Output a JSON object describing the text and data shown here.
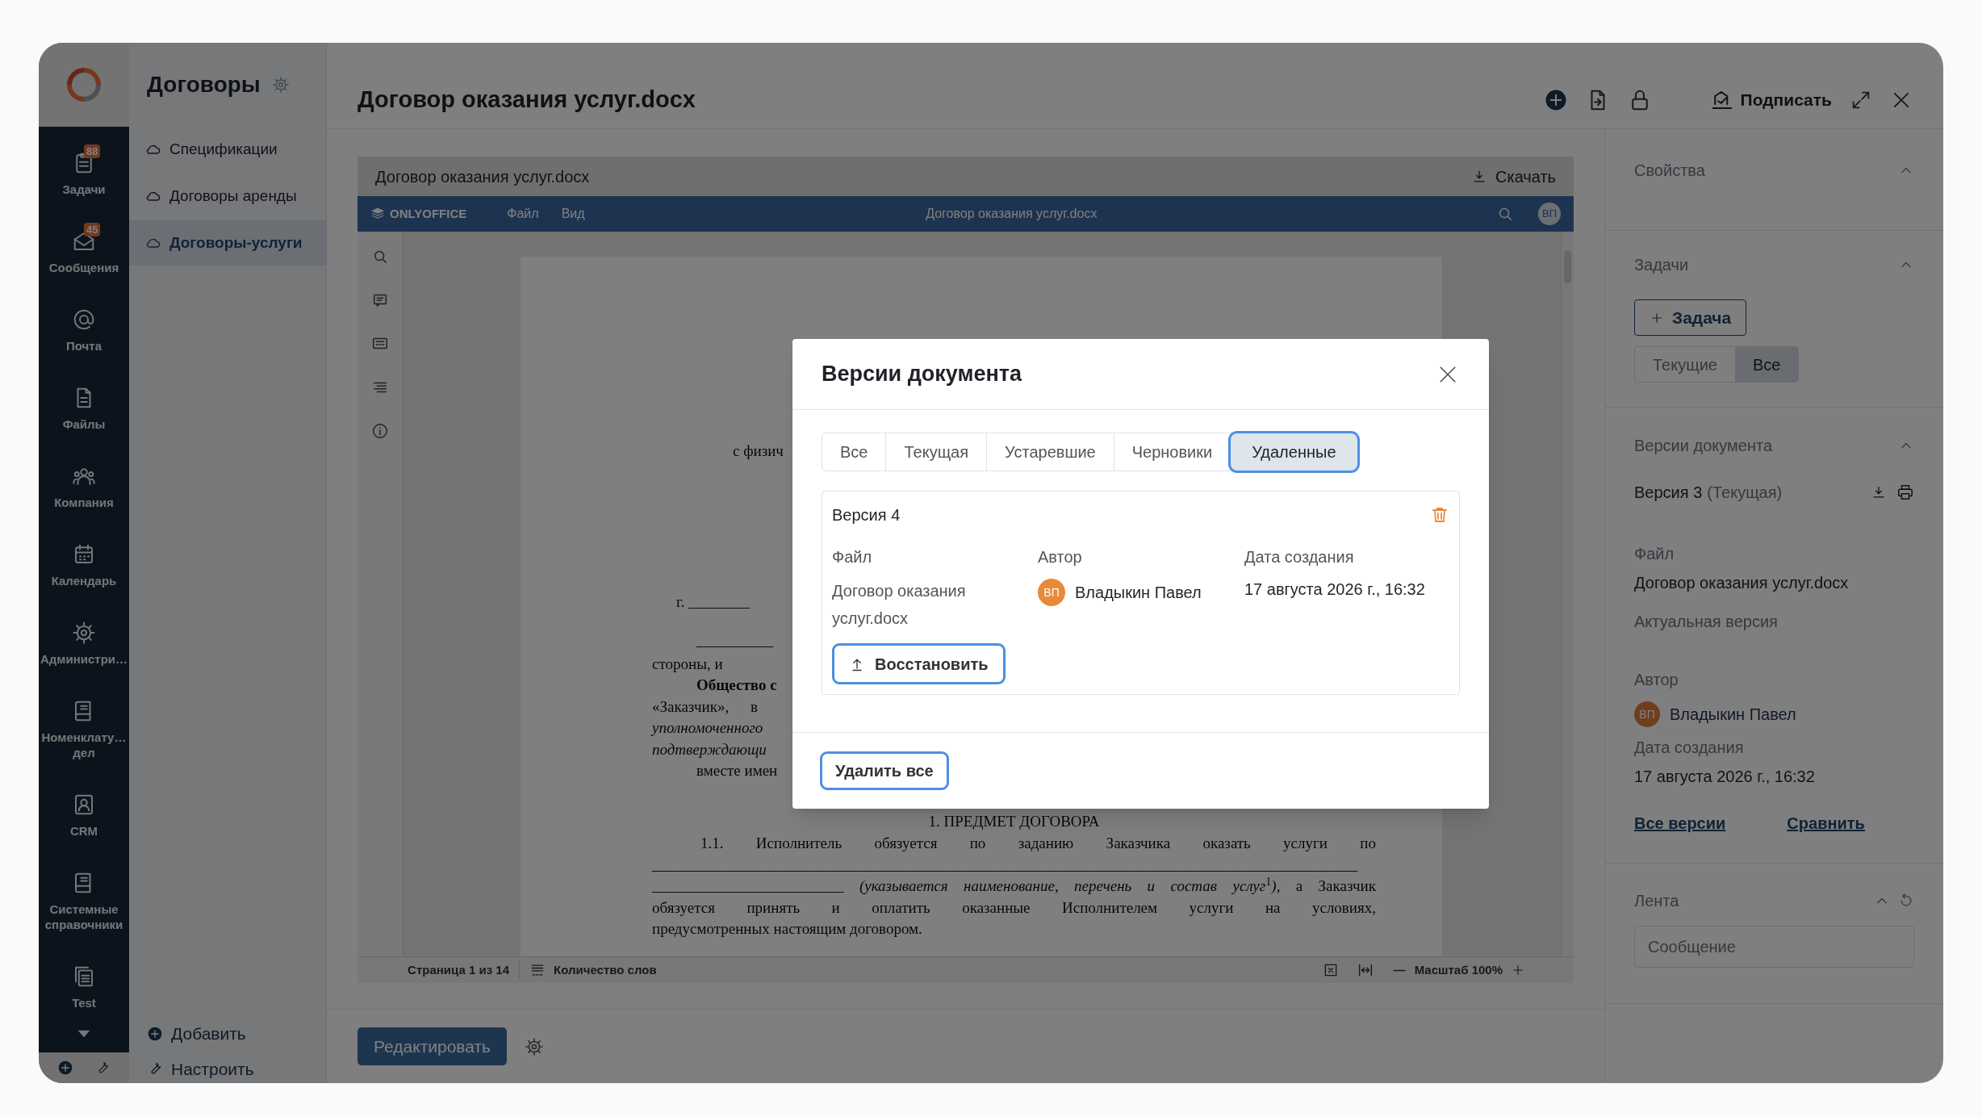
{
  "rail": {
    "items": [
      {
        "kind": "tasks",
        "label": "Задачи",
        "badge": "88"
      },
      {
        "kind": "messages",
        "label": "Сообщения",
        "badge": "45"
      },
      {
        "kind": "mail",
        "label": "Почта"
      },
      {
        "kind": "files",
        "label": "Файлы"
      },
      {
        "kind": "company",
        "label": "Компания"
      },
      {
        "kind": "calendar",
        "label": "Календарь"
      },
      {
        "kind": "admin",
        "label": "Администри…"
      },
      {
        "kind": "book",
        "label": "Номенклату… дел"
      },
      {
        "kind": "crm",
        "label": "CRM"
      },
      {
        "kind": "book",
        "label": "Системные справочники"
      },
      {
        "kind": "test",
        "label": "Test"
      }
    ]
  },
  "sidebar": {
    "title": "Договоры",
    "items": [
      {
        "label": "Спецификации",
        "selected": false
      },
      {
        "label": "Договоры аренды",
        "selected": false
      },
      {
        "label": "Договоры-услуги",
        "selected": true
      }
    ],
    "actions": [
      {
        "kind": "add",
        "label": "Добавить"
      },
      {
        "kind": "configure",
        "label": "Настроить"
      }
    ]
  },
  "header": {
    "title": "Договор оказания услуг.docx",
    "sign": "Подписать"
  },
  "viewer": {
    "file_name": "Договор оказания услуг.docx",
    "download": "Скачать",
    "brand": "ONLYOFFICE",
    "menu": [
      "Файл",
      "Вид"
    ],
    "editor_title": "Договор оказания услуг.docx",
    "user_initials": "ВП",
    "lines": [
      {
        "kind": "wide",
        "text": "с физич"
      },
      {
        "kind": "offset",
        "text": "г. ________"
      },
      {
        "kind": "indent",
        "text": "__________"
      },
      {
        "kind": "plain",
        "text": "стороны, и"
      },
      {
        "kind": "bold-indent",
        "text": "Общество с"
      },
      {
        "kind": "spread",
        "text": "«Заказчик», в"
      },
      {
        "kind": "italic",
        "text": "уполномоченного"
      },
      {
        "kind": "italic",
        "text": "подтверждающи"
      },
      {
        "kind": "indent",
        "text": "вместе имен"
      },
      {
        "kind": "heading",
        "text": "1. ПРЕДМЕТ ДОГОВОРА"
      },
      {
        "kind": "justify-indent",
        "text": "1.1. Исполнитель обязуется по заданию Заказчика оказать услуги по"
      },
      {
        "kind": "justify",
        "text": "____________________________________________________________________________________________"
      },
      {
        "kind": "justify",
        "text": "_________________________ *(указывается наименование, перечень и состав услуг*$^{1}$*)*, а Заказчик"
      },
      {
        "kind": "justify",
        "text": "обязуется принять и оплатить оказанные Исполнителем услуги на условиях,"
      },
      {
        "kind": "plain",
        "text": "предусмотренных настоящим договором."
      }
    ],
    "page_info": "Страница 1 из 14",
    "word_count": "Количество слов",
    "zoom": "Масштаб 100%"
  },
  "edit_button": "Редактировать",
  "panel": {
    "sections": [
      {
        "kind": "properties",
        "title": "Свойства"
      },
      {
        "kind": "tasks",
        "title": "Задачи",
        "add": "Задача",
        "filters": [
          {
            "label": "Текущие",
            "selected": false
          },
          {
            "label": "Все",
            "selected": true
          }
        ]
      },
      {
        "kind": "versions",
        "title": "Версии документа",
        "version": "Версия 3",
        "version_note": "(Текущая)",
        "file_label": "Файл",
        "file_name": "Договор оказания услуг.docx",
        "status": "Актуальная версия",
        "author_label": "Автор",
        "author_initials": "ВП",
        "author": "Владыкин Павел",
        "date_label": "Дата создания",
        "date": "17 августа 2026 г., 16:32",
        "links": [
          "Все версии",
          "Сравнить"
        ]
      },
      {
        "kind": "feed",
        "title": "Лента",
        "placeholder": "Сообщение"
      }
    ]
  },
  "dialog": {
    "title": "Версии документа",
    "tabs": [
      {
        "label": "Все",
        "selected": false
      },
      {
        "label": "Текущая",
        "selected": false
      },
      {
        "label": "Устаревшие",
        "selected": false
      },
      {
        "label": "Черновики",
        "selected": false
      },
      {
        "label": "Удаленные",
        "selected": true
      }
    ],
    "versions": [
      {
        "title": "Версия 4",
        "file_label": "Файл",
        "file_name": "Договор оказания услуг.docx",
        "author_label": "Автор",
        "author_initials": "ВП",
        "author": "Владыкин Павел",
        "date_label": "Дата создания",
        "date": "17 августа 2026 г., 16:32",
        "restore": "Восстановить"
      }
    ],
    "delete_all": "Удалить все"
  }
}
